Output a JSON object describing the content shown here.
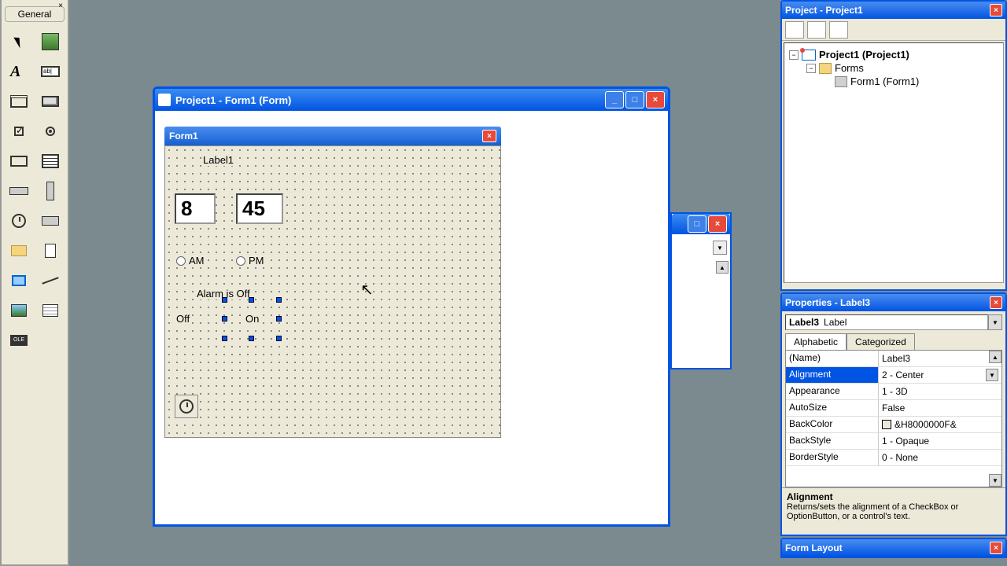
{
  "toolbox": {
    "title": "General",
    "tools": [
      {
        "name": "pointer-tool",
        "icon": "i-pointer"
      },
      {
        "name": "picturebox-tool",
        "icon": "i-pic tool-icon"
      },
      {
        "name": "label-tool",
        "icon": "i-A"
      },
      {
        "name": "textbox-tool",
        "icon": "i-textbox"
      },
      {
        "name": "frame-tool",
        "icon": "i-frame"
      },
      {
        "name": "commandbutton-tool",
        "icon": "i-button"
      },
      {
        "name": "checkbox-tool",
        "icon": "i-check"
      },
      {
        "name": "optionbutton-tool",
        "icon": "i-radio"
      },
      {
        "name": "combobox-tool",
        "icon": "i-combo"
      },
      {
        "name": "listbox-tool",
        "icon": "i-list"
      },
      {
        "name": "hscrollbar-tool",
        "icon": "i-hscroll"
      },
      {
        "name": "vscrollbar-tool",
        "icon": "i-vscroll"
      },
      {
        "name": "timer-tool",
        "icon": "i-timer"
      },
      {
        "name": "drivelistbox-tool",
        "icon": "i-drive"
      },
      {
        "name": "dirlistbox-tool",
        "icon": "i-dir"
      },
      {
        "name": "filelistbox-tool",
        "icon": "i-file"
      },
      {
        "name": "shape-tool",
        "icon": "i-shape"
      },
      {
        "name": "line-tool",
        "icon": "i-line"
      },
      {
        "name": "image-tool",
        "icon": "i-image"
      },
      {
        "name": "data-tool",
        "icon": "i-data"
      },
      {
        "name": "ole-tool",
        "icon": "i-ole"
      }
    ]
  },
  "designer": {
    "title": "Project1 - Form1 (Form)",
    "form_title": "Form1",
    "labels": {
      "label1": "Label1",
      "alarm_status": "Alarm is Off",
      "off": "Off",
      "on": "On"
    },
    "textboxes": {
      "hours": "8",
      "minutes": "45"
    },
    "radios": {
      "am": "AM",
      "pm": "PM"
    }
  },
  "project_panel": {
    "title": "Project - Project1",
    "root": "Project1 (Project1)",
    "folder": "Forms",
    "item": "Form1 (Form1)"
  },
  "properties_panel": {
    "title": "Properties - Label3",
    "object_name": "Label3",
    "object_type": "Label",
    "tabs": {
      "alpha": "Alphabetic",
      "cat": "Categorized"
    },
    "rows": [
      {
        "name": "(Name)",
        "value": "Label3"
      },
      {
        "name": "Alignment",
        "value": "2 - Center",
        "selected": true,
        "dd": true
      },
      {
        "name": "Appearance",
        "value": "1 - 3D"
      },
      {
        "name": "AutoSize",
        "value": "False"
      },
      {
        "name": "BackColor",
        "value": "&H8000000F&",
        "swatch": true
      },
      {
        "name": "BackStyle",
        "value": "1 - Opaque"
      },
      {
        "name": "BorderStyle",
        "value": "0 - None"
      }
    ],
    "desc_title": "Alignment",
    "desc_text": "Returns/sets the alignment of a CheckBox or OptionButton, or a control's text."
  },
  "formlayout_panel": {
    "title": "Form Layout"
  }
}
